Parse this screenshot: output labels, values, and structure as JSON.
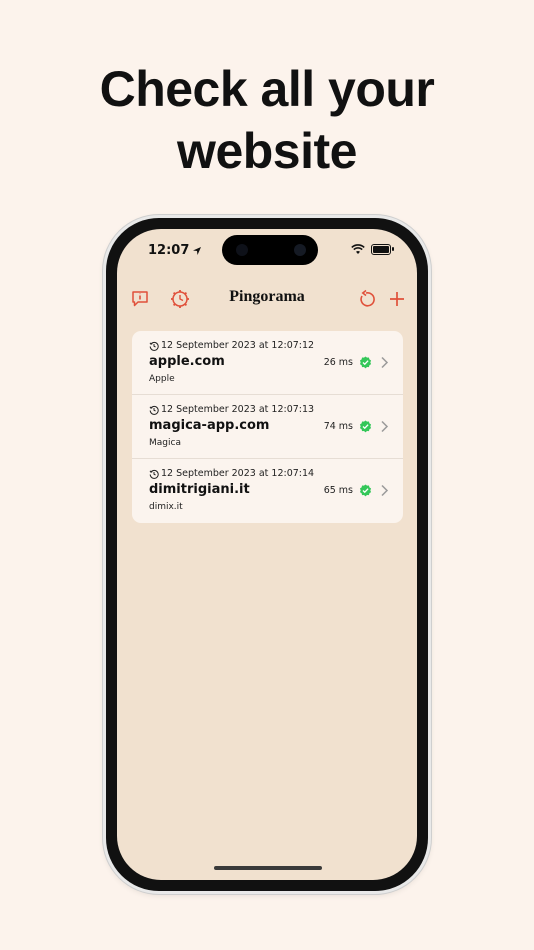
{
  "headline": {
    "line1": "Check all your",
    "line2": "website"
  },
  "status_bar": {
    "time": "12:07"
  },
  "navbar": {
    "title": "Pingorama"
  },
  "colors": {
    "accent": "#e0503a",
    "ok": "#34c759",
    "screen_bg": "#f1e1cf",
    "card_bg": "#fbf4ee"
  },
  "icons": {
    "left": [
      "info-bubble-icon",
      "gear-clock-icon"
    ],
    "right": [
      "refresh-icon",
      "plus-icon"
    ],
    "row": [
      "history-clock-icon",
      "check-seal-icon",
      "chevron-right-icon"
    ]
  },
  "sites": [
    {
      "date": "12 September 2023 at 12:07:12",
      "host": "apple.com",
      "name": "Apple",
      "latency": "26 ms"
    },
    {
      "date": "12 September 2023 at 12:07:13",
      "host": "magica-app.com",
      "name": "Magica",
      "latency": "74 ms"
    },
    {
      "date": "12 September 2023 at 12:07:14",
      "host": "dimitrigiani.it",
      "name": "dimix.it",
      "latency": "65 ms"
    }
  ]
}
